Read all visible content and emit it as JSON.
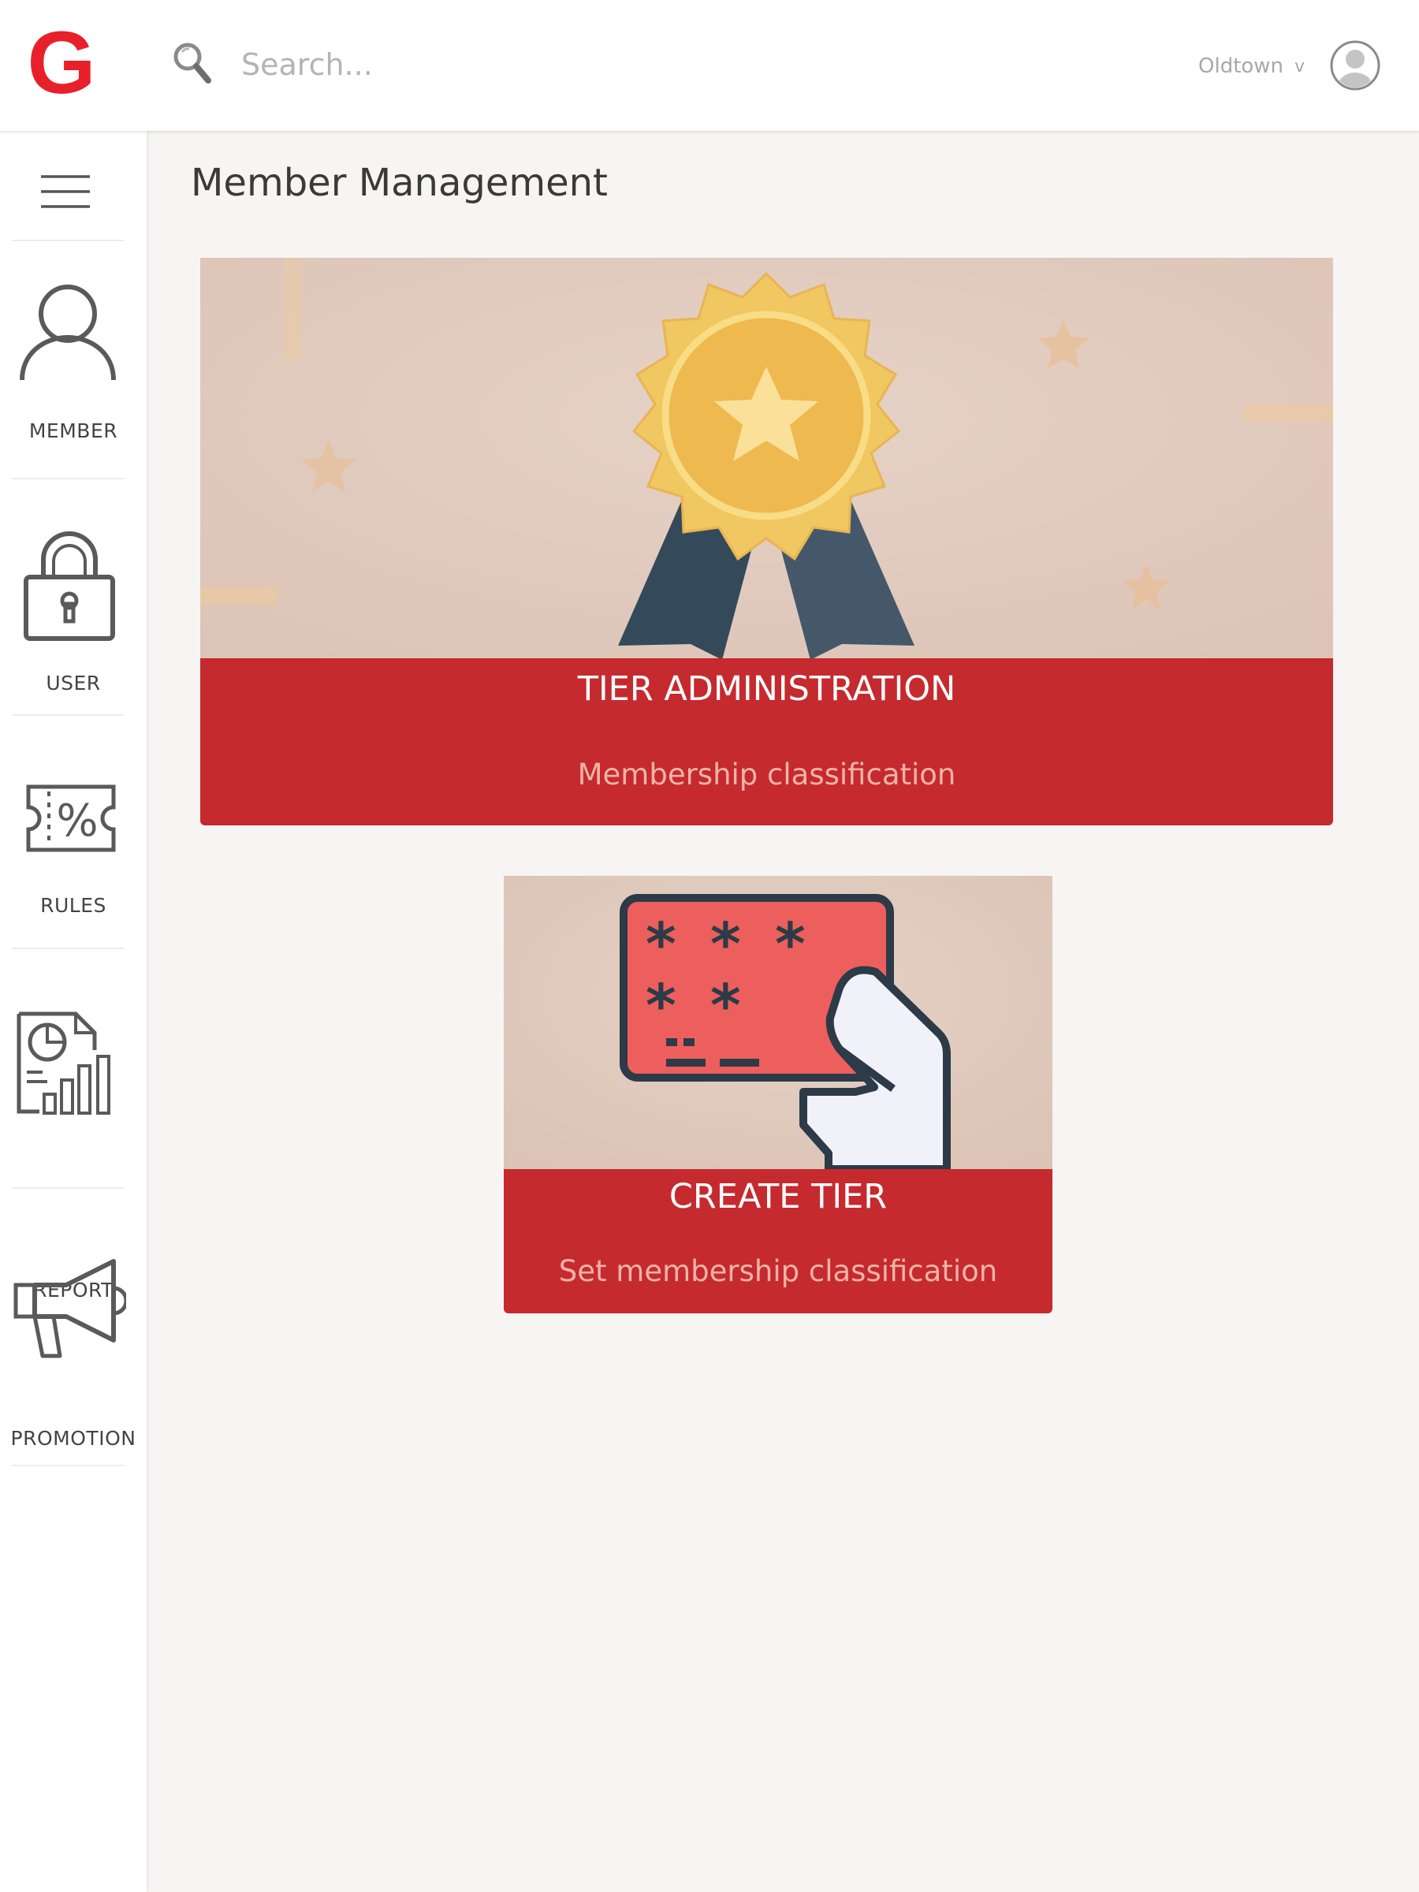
{
  "header": {
    "logo_letter": "G",
    "search": {
      "placeholder": "Search..."
    },
    "location": {
      "value": "Oldtown",
      "caret": "v"
    },
    "icons": {
      "search": "search-icon",
      "avatar": "avatar-icon"
    }
  },
  "sidebar": {
    "menu_icon": "hamburger-menu-icon",
    "items": [
      {
        "label": "MEMBER",
        "icon": "member-person-icon"
      },
      {
        "label": "USER",
        "icon": "user-lock-icon"
      },
      {
        "label": "RULES",
        "icon": "rules-percent-ticket-icon"
      },
      {
        "label": "REPORT",
        "icon": "report-chart-icon"
      },
      {
        "label": "PROMOTION",
        "icon": "promotion-megaphone-icon"
      }
    ]
  },
  "main": {
    "title": "Member Management",
    "cards": [
      {
        "title": "TIER ADMINISTRATION",
        "subtitle": "Membership classification",
        "image_icon": "award-medal-icon"
      },
      {
        "title": "CREATE TIER",
        "subtitle": "Set membership classification",
        "image_icon": "card-in-hand-icon"
      }
    ]
  },
  "colors": {
    "accent_red": "#c52a2e",
    "logo_red": "#e8202a",
    "subtitle_pink": "#f0b3a6",
    "card_background": "#e2cbbd",
    "medal_gold": "#f0c760",
    "ribbon_dark": "#3d4f5c",
    "page_background": "#f6f5f4"
  }
}
